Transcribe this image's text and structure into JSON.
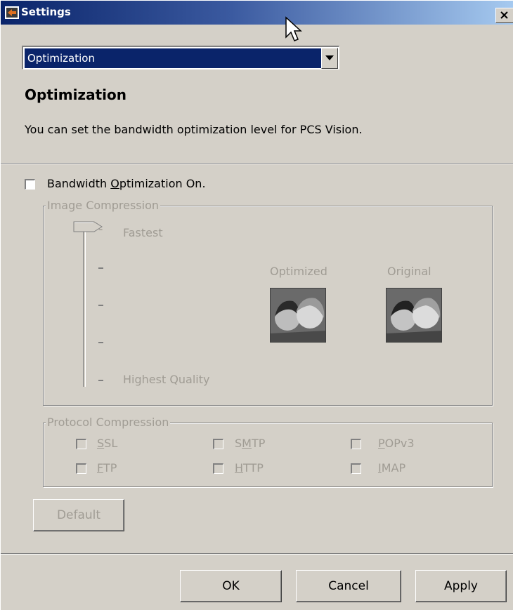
{
  "window": {
    "title": "Settings"
  },
  "dropdown": {
    "selected": "Optimization"
  },
  "page": {
    "heading": "Optimization",
    "description": "You can set the bandwidth optimization level for PCS Vision."
  },
  "bandwidth": {
    "label_pre": "Bandwidth ",
    "label_mnemonic": "O",
    "label_post": "ptimization On.",
    "checked": false
  },
  "image_compression": {
    "title": "Image Compression",
    "slider": {
      "top_label": "Fastest",
      "bottom_label": "Highest Quality",
      "level": 0,
      "tick_label": "-"
    },
    "optimized_label": "Optimized",
    "original_label": "Original"
  },
  "protocol_compression": {
    "title": "Protocol Compression",
    "items": [
      {
        "pre": "",
        "mnemonic": "S",
        "post": "SL"
      },
      {
        "pre": "S",
        "mnemonic": "M",
        "post": "TP"
      },
      {
        "pre": "",
        "mnemonic": "P",
        "post": "OPv3"
      },
      {
        "pre": "",
        "mnemonic": "F",
        "post": "TP"
      },
      {
        "pre": "",
        "mnemonic": "H",
        "post": "TTP"
      },
      {
        "pre": "",
        "mnemonic": "I",
        "post": "MAP"
      }
    ]
  },
  "buttons": {
    "default": "Default",
    "ok": "OK",
    "cancel": "Cancel",
    "apply": "Apply"
  },
  "colors": {
    "title_start": "#0a246a",
    "title_end": "#a6caf0",
    "face": "#d4d0c8",
    "disabled_text": "#a09c94"
  }
}
